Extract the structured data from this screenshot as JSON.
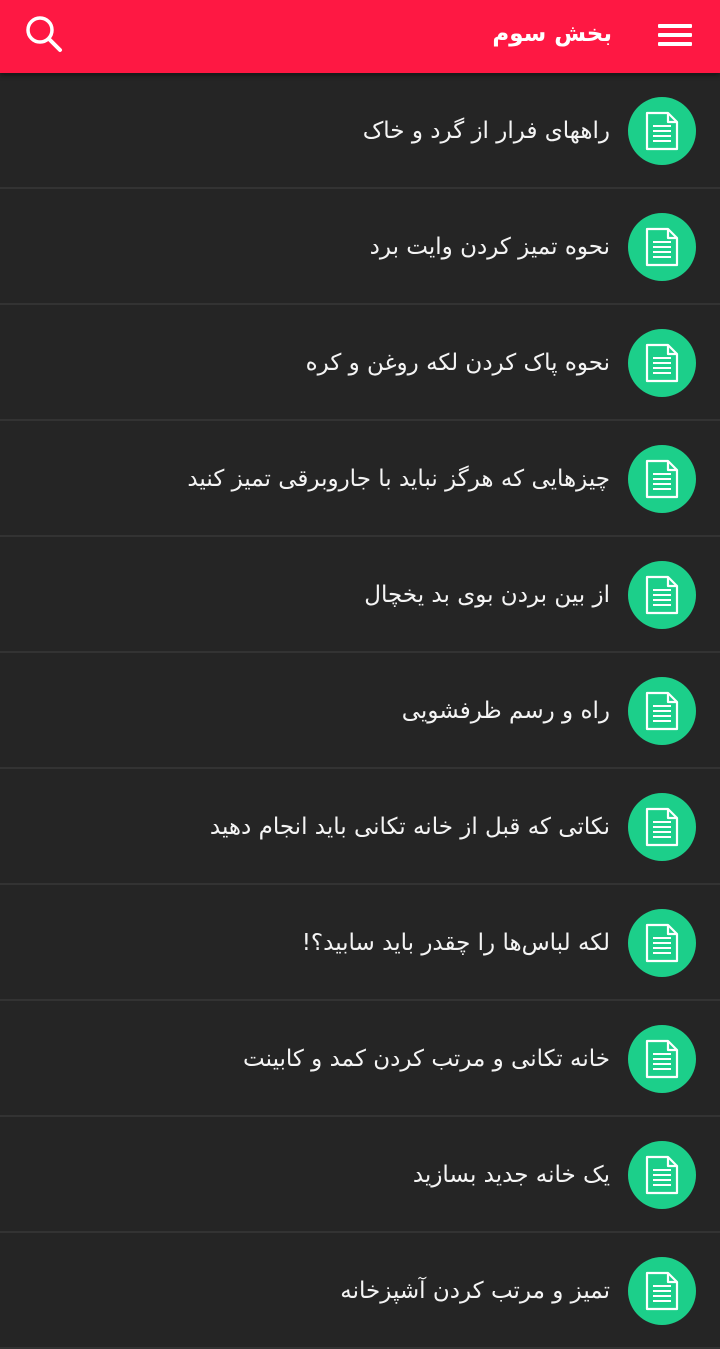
{
  "header": {
    "title": "بخش سوم",
    "menu_icon": "hamburger-menu-icon",
    "search_icon": "search-icon",
    "background_color": "#fe1843"
  },
  "list": {
    "item_icon": "document-icon",
    "icon_color": "#1ccf8a",
    "background_color": "#252525",
    "items": [
      {
        "label": "راههای فرار از گرد و خاک"
      },
      {
        "label": "نحوه تمیز کردن وایت برد"
      },
      {
        "label": "نحوه پاک کردن لکه روغن و کره"
      },
      {
        "label": "چیزهایی که هرگز نباید با جاروبرقی تمیز کنید"
      },
      {
        "label": "از بین بردن بوی بد یخچال"
      },
      {
        "label": "راه و رسم ظرفشویی"
      },
      {
        "label": "نکاتی که قبل از خانه تکانی باید انجام دهید"
      },
      {
        "label": "لکه لباس‌ها را چقدر باید سابید؟!"
      },
      {
        "label": "خانه تکانی و مرتب کردن کمد و کابینت"
      },
      {
        "label": "یک خانه جدید بسازید"
      },
      {
        "label": "تمیز و مرتب کردن آشپزخانه"
      }
    ]
  }
}
